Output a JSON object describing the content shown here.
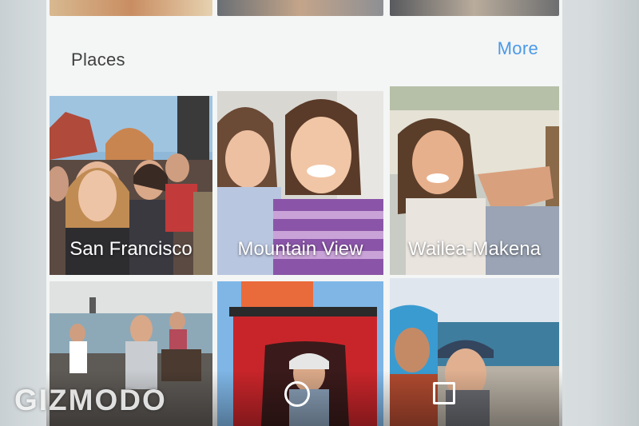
{
  "places_section": {
    "title": "Places",
    "more_label": "More",
    "tiles": [
      {
        "label": "San Francisco"
      },
      {
        "label": "Mountain View"
      },
      {
        "label": "Wailea-Makena"
      },
      {
        "label": ""
      },
      {
        "label": ""
      },
      {
        "label": ""
      }
    ]
  },
  "navigation": {
    "home_icon": "circle-home-icon",
    "recents_icon": "square-recents-icon"
  },
  "watermark": "GIZMODO",
  "colors": {
    "accent": "#4a9ae8",
    "title": "#404040",
    "screen_background": "#f4f5f5"
  }
}
